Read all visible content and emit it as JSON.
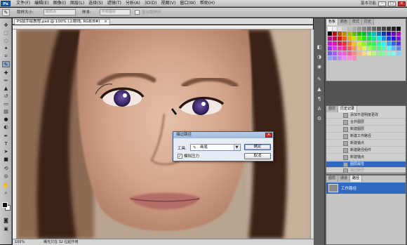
{
  "app": {
    "logo": "Ps",
    "ws_basic": "基本功能"
  },
  "menu": [
    "文件(F)",
    "编辑(E)",
    "图像(I)",
    "图层(L)",
    "选择(S)",
    "滤镜(T)",
    "分析(A)",
    "3D(D)",
    "视图(V)",
    "窗口(W)",
    "帮助(H)"
  ],
  "options": {
    "sample_size_label": "取样大小:",
    "sample_size_value": "取样点",
    "sample_label": "样本:",
    "sample_value": "所有图层",
    "ring_label": "显示取样环"
  },
  "document": {
    "tab_title": "PS鼠手绘教程.psd @ 100% (上眼线, RGB/8#)",
    "zoom": "100%",
    "status": "曝光只在 32 位起作用"
  },
  "dialog": {
    "title": "描边路径",
    "tool_label": "工具:",
    "tool_value": "画笔",
    "simulate_label": "模拟压力",
    "ok": "确定",
    "cancel": "取消"
  },
  "swatch_panel": {
    "tabs": [
      "色板",
      "颜色",
      "样式",
      "历史"
    ]
  },
  "history_panel": {
    "tabs": [
      "图层",
      "历史记录"
    ],
    "items": [
      {
        "label": "添加不透明度更改"
      },
      {
        "label": "合并图层"
      },
      {
        "label": "新建图层"
      },
      {
        "label": "新建工作路径"
      },
      {
        "label": "新建锚点"
      },
      {
        "label": "新建路径组件"
      },
      {
        "label": "新建锚点"
      },
      {
        "label": "图层属性"
      },
      {
        "label": "描边路径"
      }
    ]
  },
  "paths_panel": {
    "tabs": [
      "图层",
      "通道",
      "路径"
    ],
    "item": "工作路径"
  },
  "colors": {
    "selection": "#3168c2",
    "iris": "#4b2f79",
    "hair": "#3a2217"
  }
}
